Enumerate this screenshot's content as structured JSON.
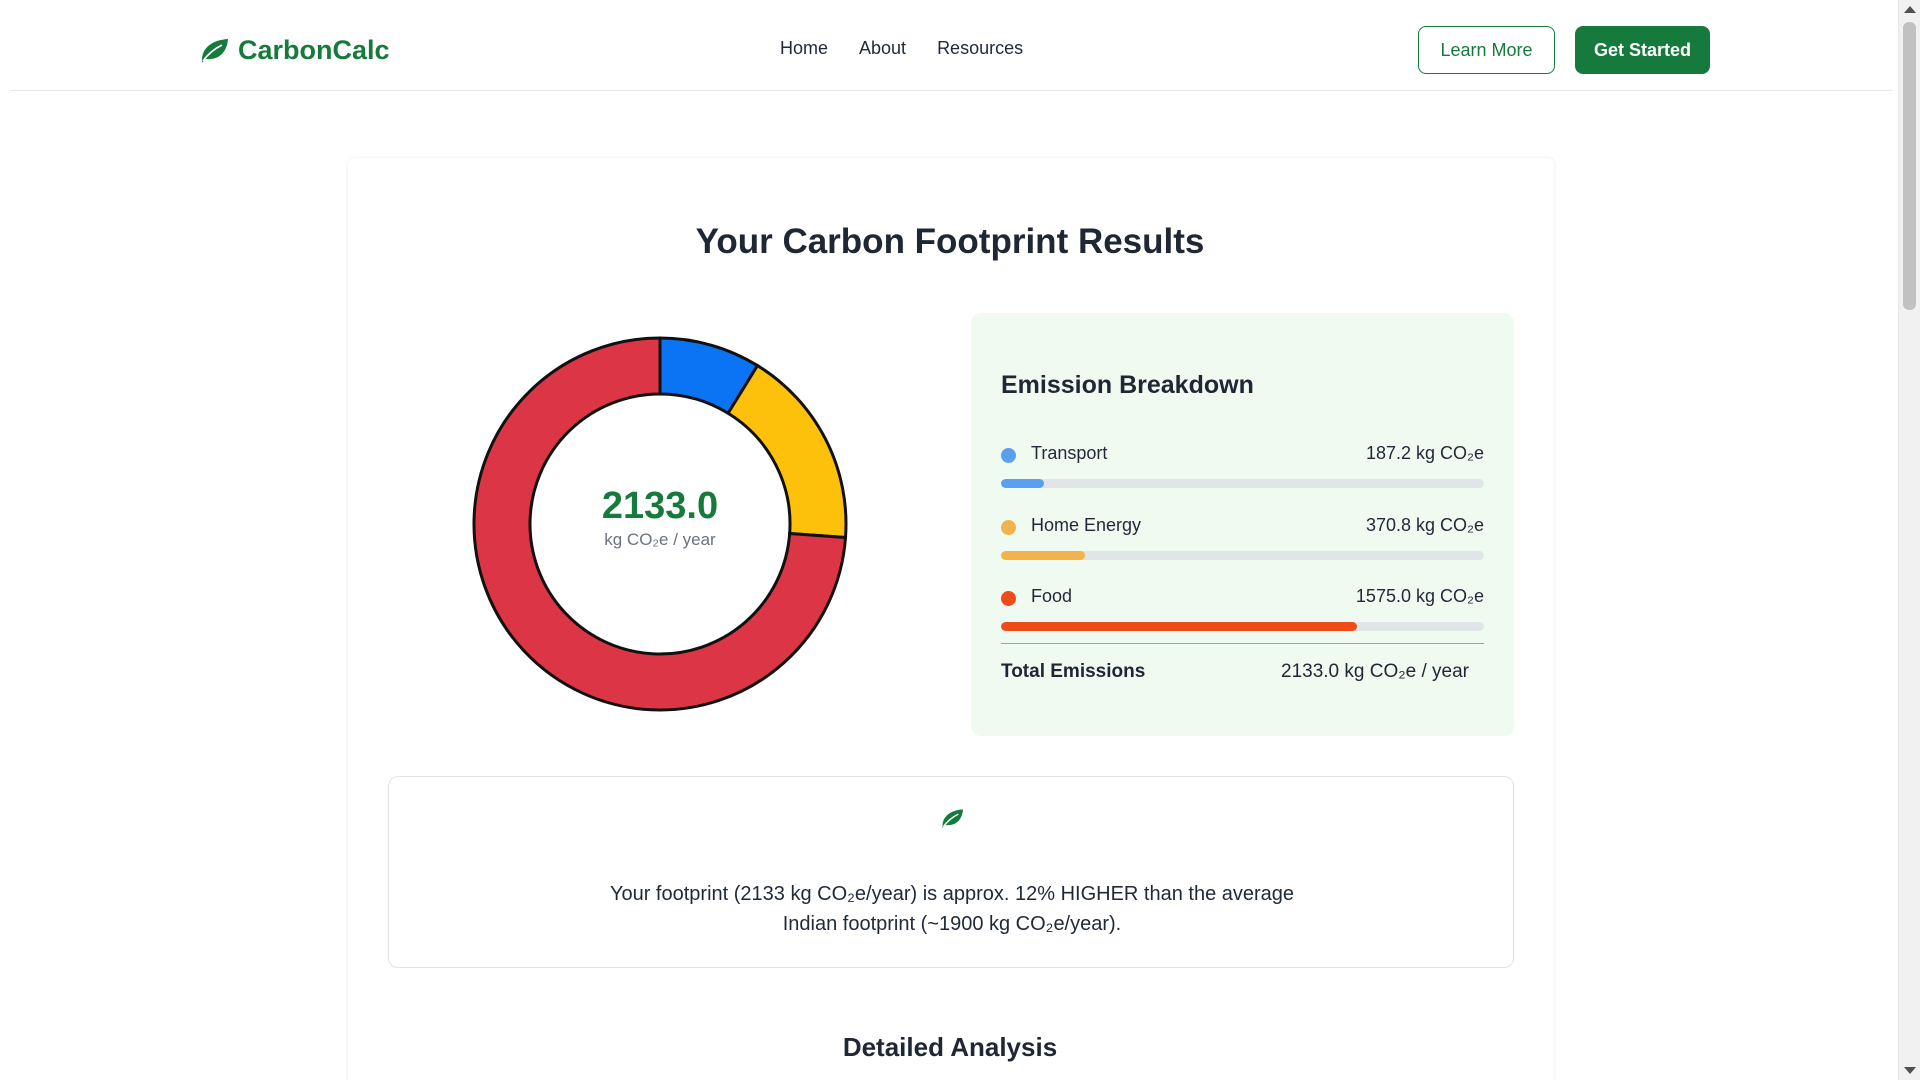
{
  "header": {
    "brand": "CarbonCalc",
    "nav": [
      "Home",
      "About",
      "Resources"
    ],
    "learn_more": "Learn More",
    "get_started": "Get Started"
  },
  "results": {
    "title": "Your Carbon Footprint Results",
    "total": "2133.0",
    "total_unit": "kg CO₂e / year"
  },
  "chart_data": {
    "type": "pie",
    "categories": [
      "Transport",
      "Home Energy",
      "Food"
    ],
    "values": [
      187.2,
      370.8,
      1575.0
    ],
    "colors": [
      "#0a74f5",
      "#fdc00b",
      "#dc3545"
    ],
    "donut": true
  },
  "breakdown": {
    "title": "Emission Breakdown",
    "items": [
      {
        "name": "Transport",
        "value": "187.2 kg CO₂e",
        "dot_color": "#5b9ff0",
        "bar_color": "#5b9ff0",
        "fraction": 0.088
      },
      {
        "name": "Home Energy",
        "value": "370.8 kg CO₂e",
        "dot_color": "#f4b24a",
        "bar_color": "#f4b24a",
        "fraction": 0.174
      },
      {
        "name": "Food",
        "value": "1575.0 kg CO₂e",
        "dot_color": "#ee4b1a",
        "bar_color": "#ee4b1a",
        "fraction": 0.738
      }
    ],
    "total_label": "Total Emissions",
    "total_value": "2133.0 kg CO₂e / year"
  },
  "comparison": {
    "icon": "leaf-icon",
    "text_line1": "Your footprint (2133 kg CO₂e/year) is approx. 12% HIGHER than the average",
    "text_line2": "Indian footprint (~1900 kg CO₂e/year)."
  },
  "detailed_analysis_title": "Detailed Analysis",
  "colors": {
    "brand_green": "#167a3c",
    "panel_bg": "#effaf1"
  }
}
